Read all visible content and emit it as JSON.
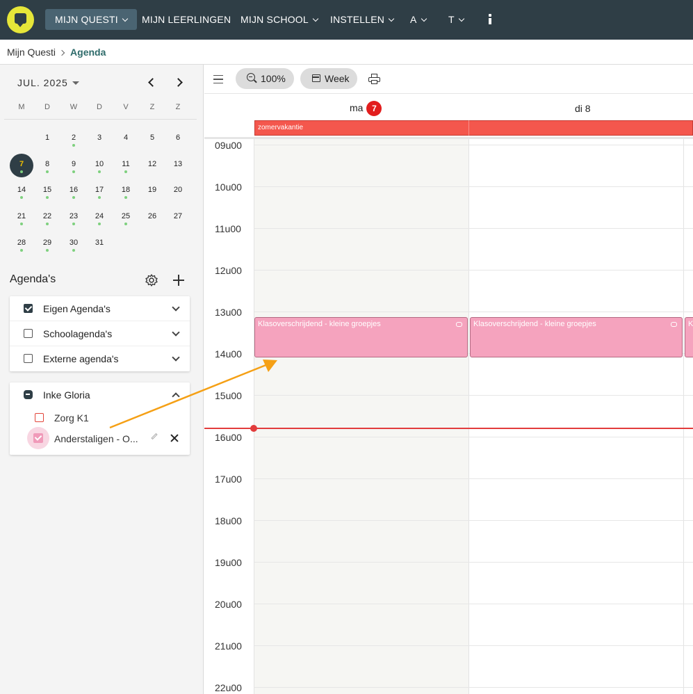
{
  "nav": {
    "items": [
      {
        "label": "MIJN QUESTI",
        "dropdown": true,
        "active": true
      },
      {
        "label": "MIJN LEERLINGEN",
        "dropdown": false,
        "active": false
      },
      {
        "label": "MIJN SCHOOL",
        "dropdown": true,
        "active": false
      },
      {
        "label": "INSTELLEN",
        "dropdown": true,
        "active": false
      },
      {
        "label": "A",
        "dropdown": true,
        "active": false
      },
      {
        "label": "T",
        "dropdown": true,
        "active": false
      }
    ],
    "info_icon": "info-icon"
  },
  "breadcrumb": {
    "root": "Mijn Questi",
    "current": "Agenda"
  },
  "minical": {
    "month_label": "JUL. 2025",
    "weekdays": [
      "M",
      "D",
      "W",
      "D",
      "V",
      "Z",
      "Z"
    ],
    "weeks": [
      [
        "",
        "1",
        "2",
        "3",
        "4",
        "5",
        "6"
      ],
      [
        "7",
        "8",
        "9",
        "10",
        "11",
        "12",
        "13"
      ],
      [
        "14",
        "15",
        "16",
        "17",
        "18",
        "19",
        "20"
      ],
      [
        "21",
        "22",
        "23",
        "24",
        "25",
        "26",
        "27"
      ],
      [
        "28",
        "29",
        "30",
        "31",
        "",
        "",
        ""
      ]
    ],
    "event_days": [
      "2",
      "7",
      "8",
      "9",
      "10",
      "11",
      "14",
      "15",
      "16",
      "17",
      "18",
      "21",
      "22",
      "23",
      "24",
      "25",
      "28",
      "29",
      "30"
    ],
    "today": "7"
  },
  "agendas": {
    "title": "Agenda's",
    "groups": [
      {
        "label": "Eigen Agenda's",
        "checked": true
      },
      {
        "label": "Schoolagenda's",
        "checked": false
      },
      {
        "label": "Externe agenda's",
        "checked": false
      }
    ],
    "user": {
      "name": "Inke Gloria",
      "subs": [
        {
          "label": "Zorg K1",
          "color": "#e2453a"
        },
        {
          "label": "Anderstaligen - O...",
          "color": "#f09ab9"
        }
      ]
    }
  },
  "toolbar": {
    "zoom": "100%",
    "view": "Week"
  },
  "days": {
    "mon_label": "ma",
    "mon_badge": "7",
    "tue_label": "di 8"
  },
  "allday": {
    "label": "zomervakantie"
  },
  "hours": [
    "09u00",
    "10u00",
    "11u00",
    "12u00",
    "13u00",
    "14u00",
    "15u00",
    "16u00",
    "17u00",
    "18u00",
    "19u00",
    "20u00",
    "21u00",
    "22u00"
  ],
  "events": [
    {
      "title": "Klasoverschrijdend - kleine groepjes",
      "day": "ma"
    },
    {
      "title": "Klasoverschrijdend - kleine groepjes",
      "day": "di"
    },
    {
      "title": "K",
      "day": "wo"
    }
  ],
  "colors": {
    "topbar": "#2f3e46",
    "logo": "#e6e639",
    "event": "#f5a3be",
    "allday": "#f4574d",
    "now_line": "#e23c3c",
    "annotation_arrow": "#f5a015"
  }
}
